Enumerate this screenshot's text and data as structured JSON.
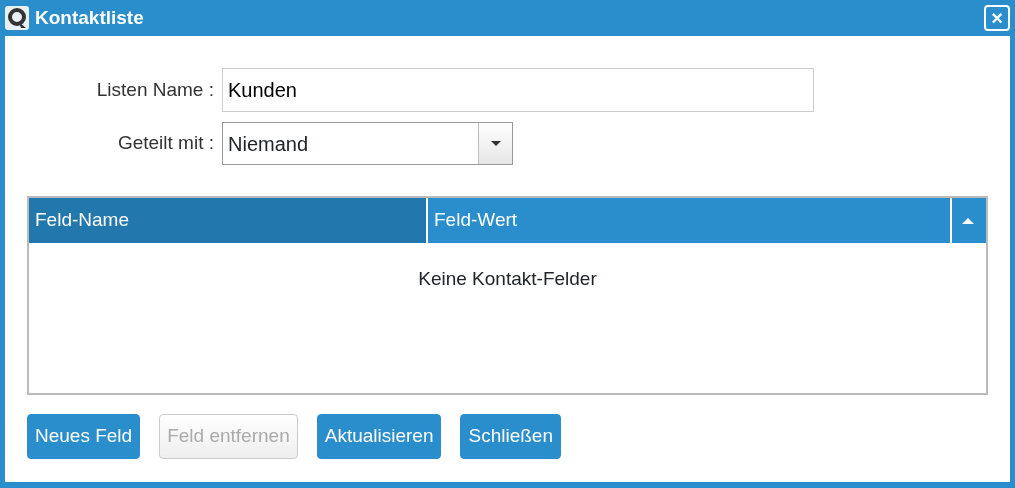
{
  "window": {
    "title": "Kontaktliste",
    "close": "×"
  },
  "form": {
    "fields": [
      {
        "kind": "text",
        "label": "Listen Name :",
        "value": "Kunden"
      },
      {
        "kind": "select",
        "label": "Geteilt mit :",
        "value": "Niemand"
      }
    ]
  },
  "table": {
    "columns": [
      {
        "label": "Feld-Name",
        "sorted": true
      },
      {
        "label": "Feld-Wert",
        "sorted": false
      }
    ],
    "empty_text": "Keine Kontakt-Felder"
  },
  "buttons": [
    {
      "label": "Neues Feld",
      "disabled": false
    },
    {
      "label": "Feld entfernen",
      "disabled": true
    },
    {
      "label": "Aktualisieren",
      "disabled": false
    },
    {
      "label": "Schließen",
      "disabled": false
    }
  ]
}
